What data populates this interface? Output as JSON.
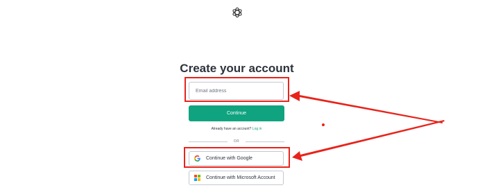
{
  "page": {
    "title": "Create your account"
  },
  "form": {
    "email_placeholder": "Email address",
    "continue_label": "Continue",
    "login_prompt": "Already have an account?",
    "login_link": "Log in",
    "divider_text": "OR"
  },
  "social": {
    "google_label": "Continue with Google",
    "microsoft_label": "Continue with Microsoft Account"
  },
  "colors": {
    "brand": "#10a37f",
    "annotation": "#e8231b",
    "microsoft_tiles": [
      "#f25022",
      "#7fba00",
      "#00a4ef",
      "#ffb900"
    ]
  },
  "icons": {
    "logo": "openai-logo-icon",
    "google": "google-icon",
    "microsoft": "microsoft-icon"
  }
}
